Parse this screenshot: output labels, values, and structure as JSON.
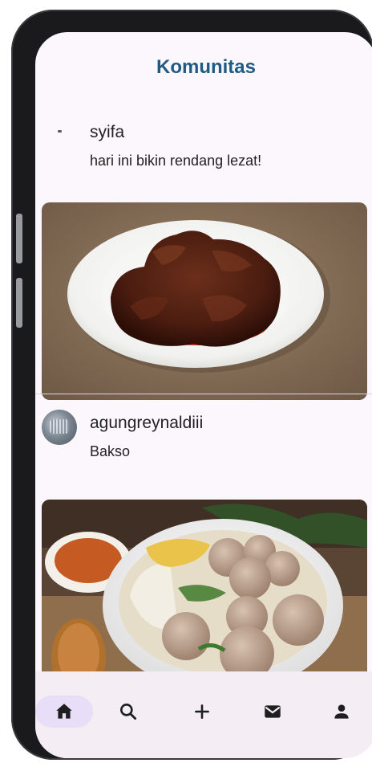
{
  "app": {
    "title": "Komunitas"
  },
  "posts": [
    {
      "username": "syifa",
      "caption": "hari ini bikin rendang lezat!",
      "avatar_icon": "avatar-placeholder",
      "image": "rendang-photo"
    },
    {
      "username": "agungreynaldiii",
      "caption": "Bakso",
      "avatar_icon": "avatar-photo",
      "image": "bakso-photo"
    }
  ],
  "bottom_nav": {
    "items": [
      {
        "icon": "home-icon",
        "active": true
      },
      {
        "icon": "search-icon",
        "active": false
      },
      {
        "icon": "add-icon",
        "active": false
      },
      {
        "icon": "mail-icon",
        "active": false
      },
      {
        "icon": "person-icon",
        "active": false
      }
    ]
  },
  "colors": {
    "title": "#1f5a82",
    "screen_bg": "#fcf7fc",
    "nav_bg": "#f4edf4",
    "nav_active_pill": "#e9def8",
    "icon": "#1e1e1e"
  }
}
